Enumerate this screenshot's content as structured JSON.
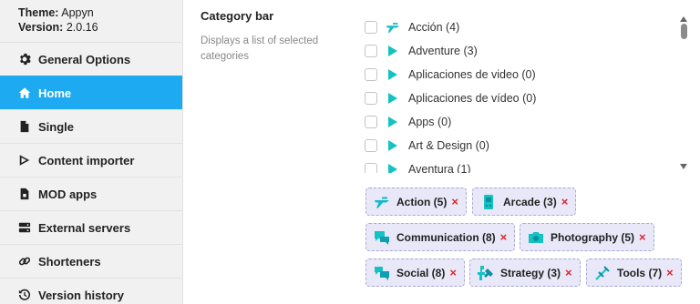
{
  "sidebar": {
    "theme_label": "Theme:",
    "theme_value": "Appyn",
    "version_label": "Version:",
    "version_value": "2.0.16",
    "items": [
      {
        "label": "General Options",
        "icon": "gear-icon"
      },
      {
        "label": "Home",
        "icon": "home-icon",
        "active": true
      },
      {
        "label": "Single",
        "icon": "file-icon"
      },
      {
        "label": "Content importer",
        "icon": "play-arrow-icon"
      },
      {
        "label": "MOD apps",
        "icon": "mod-file-icon"
      },
      {
        "label": "External servers",
        "icon": "server-icon"
      },
      {
        "label": "Shorteners",
        "icon": "link-icon"
      },
      {
        "label": "Version history",
        "icon": "history-icon"
      }
    ]
  },
  "main": {
    "title": "Category bar",
    "description": "Displays a list of selected categories"
  },
  "categories": [
    {
      "label": "Acción (4)",
      "icon": "action-icon"
    },
    {
      "label": "Adventure (3)",
      "icon": "play-triangle-icon"
    },
    {
      "label": "Aplicaciones de video (0)",
      "icon": "play-triangle-icon"
    },
    {
      "label": "Aplicaciones de vídeo (0)",
      "icon": "play-triangle-icon"
    },
    {
      "label": "Apps (0)",
      "icon": "play-triangle-icon"
    },
    {
      "label": "Art & Design (0)",
      "icon": "play-triangle-icon"
    },
    {
      "label": "Aventura (1)",
      "icon": "play-triangle-icon"
    }
  ],
  "selected": [
    {
      "label": "Action (5)",
      "remove": "×",
      "icon": "action-icon"
    },
    {
      "label": "Arcade (3)",
      "remove": "×",
      "icon": "arcade-icon"
    },
    {
      "label": "Communication (8)",
      "remove": "×",
      "icon": "communication-icon"
    },
    {
      "label": "Photography (5)",
      "remove": "×",
      "icon": "photography-icon"
    },
    {
      "label": "Social (8)",
      "remove": "×",
      "icon": "social-icon"
    },
    {
      "label": "Strategy (3)",
      "remove": "×",
      "icon": "strategy-icon"
    },
    {
      "label": "Tools (7)",
      "remove": "×",
      "icon": "tools-icon"
    }
  ],
  "colors": {
    "active": "#1eaaf1",
    "icon_teal": "#15c2c2",
    "chip_bg": "#e8e8f8",
    "remove": "#e0262f"
  }
}
